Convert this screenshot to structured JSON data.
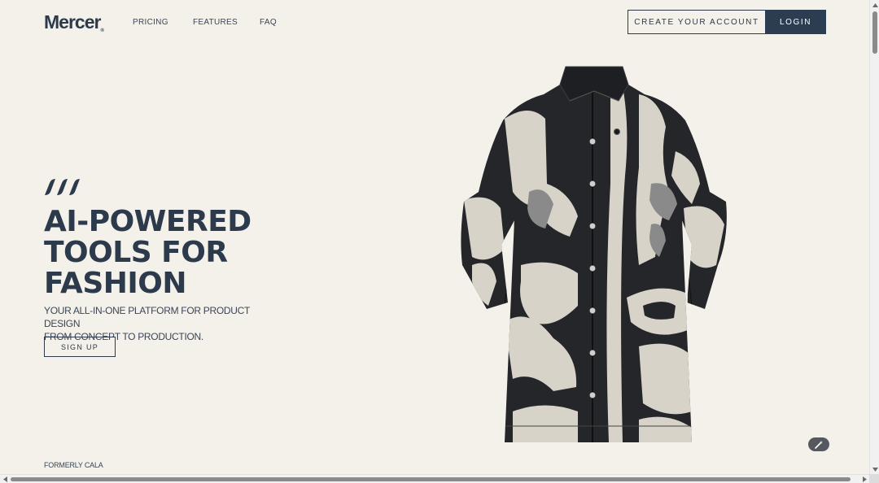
{
  "nav": {
    "logo_text": "Mercer",
    "logo_mark": "®",
    "links": [
      {
        "label": "PRICING"
      },
      {
        "label": "FEATURES"
      },
      {
        "label": "FAQ"
      }
    ],
    "create_account_label": "CREATE YOUR ACCOUNT",
    "login_label": "LOGIN"
  },
  "hero": {
    "title_lines": [
      "AI-POWERED",
      "TOOLS FOR",
      "FASHION"
    ],
    "subtitle_lines": [
      "YOUR ALL-IN-ONE PLATFORM FOR PRODUCT DESIGN",
      "FROM CONCEPT TO PRODUCTION."
    ],
    "signup_label": "SIGN UP",
    "product_image": "black-and-cream-patterned-leather-coat",
    "brand_mark_icon": "triple-slash-logo-icon"
  },
  "footer_note": "FORMERLY CALA",
  "floating_button_icon": "magic-wand-icon",
  "colors": {
    "background": "#f3f1ea",
    "brand_navy": "#2c3d52",
    "text": "#2c3a4c"
  }
}
